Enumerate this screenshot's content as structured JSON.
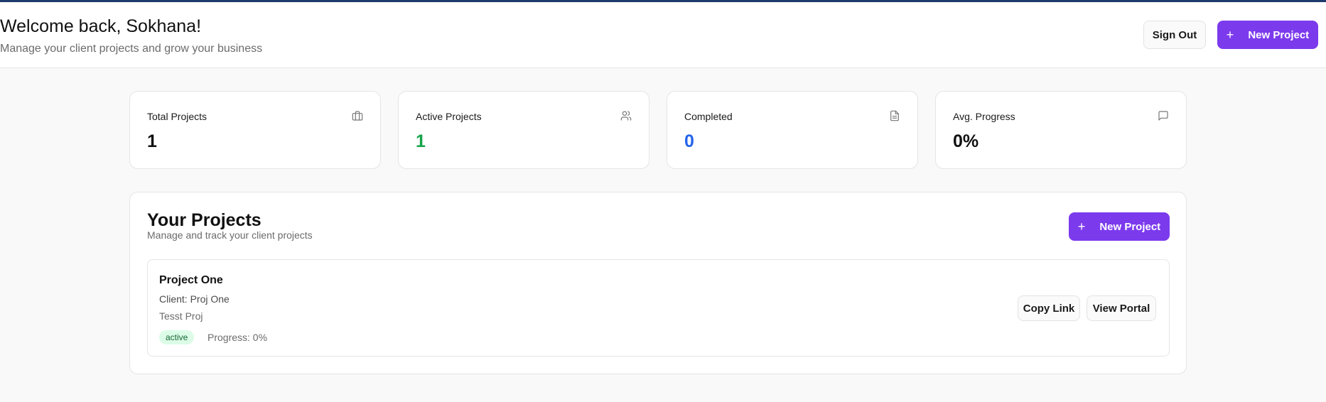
{
  "header": {
    "welcome": "Welcome back, Sokhana!",
    "subtitle": "Manage your client projects and grow your business",
    "sign_out_label": "Sign Out",
    "new_project_label": "New Project"
  },
  "stats": [
    {
      "label": "Total Projects",
      "value": "1",
      "icon": "briefcase-icon",
      "color": "#111111"
    },
    {
      "label": "Active Projects",
      "value": "1",
      "icon": "users-icon",
      "color": "#16a34a"
    },
    {
      "label": "Completed",
      "value": "0",
      "icon": "document-icon",
      "color": "#2563eb"
    },
    {
      "label": "Avg. Progress",
      "value": "0%",
      "icon": "message-icon",
      "color": "#111111"
    }
  ],
  "projects_panel": {
    "title": "Your Projects",
    "subtitle": "Manage and track your client projects",
    "new_project_label": "New Project",
    "items": [
      {
        "name": "Project One",
        "client": "Client: Proj One",
        "description": "Tesst Proj",
        "status": "active",
        "progress": "Progress: 0%",
        "copy_link_label": "Copy Link",
        "view_portal_label": "View Portal"
      }
    ]
  },
  "colors": {
    "accent": "#7c3aed",
    "top_border": "#1e3a6d",
    "badge_bg": "#dcfce7",
    "badge_text": "#166534"
  }
}
